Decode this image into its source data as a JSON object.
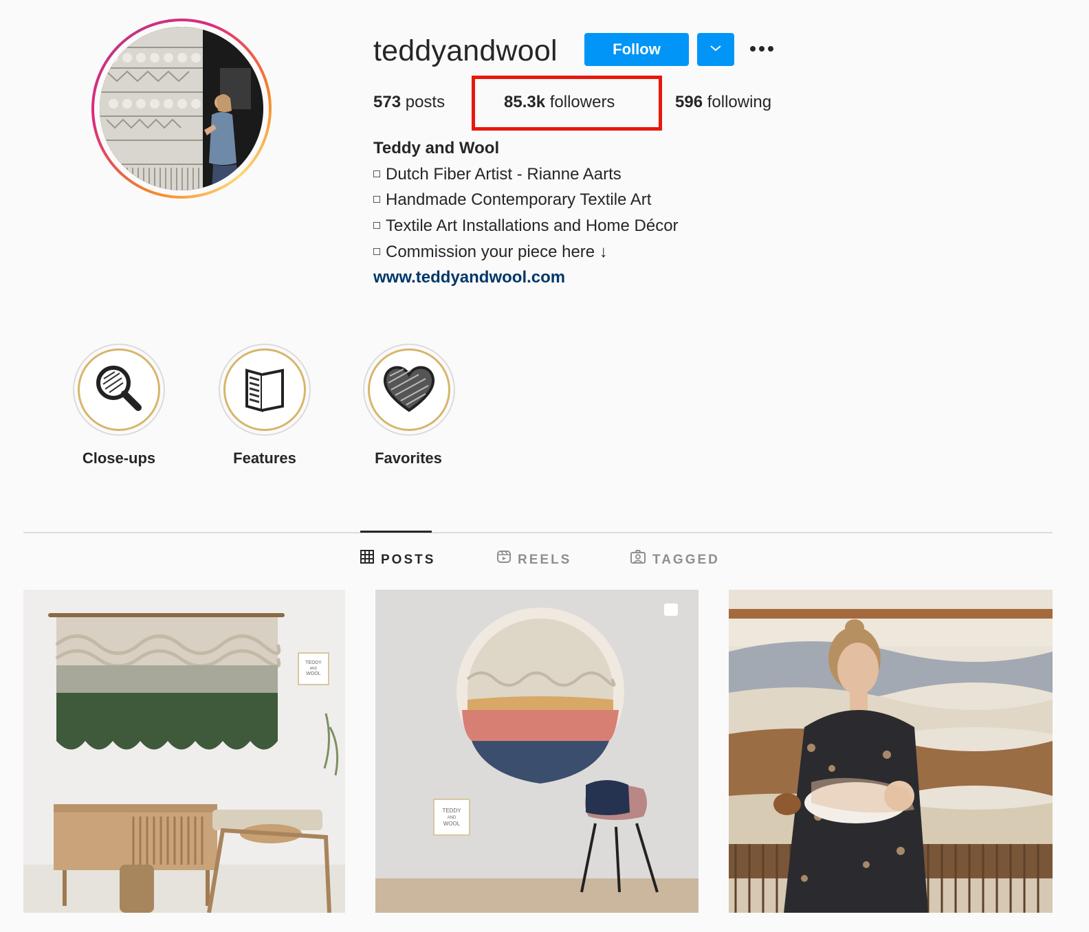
{
  "profile": {
    "username": "teddyandwool",
    "follow_label": "Follow",
    "stats": {
      "posts_count": "573",
      "posts_label": "posts",
      "followers_count": "85.3k",
      "followers_label": "followers",
      "following_count": "596",
      "following_label": "following"
    },
    "bio": {
      "name": "Teddy and Wool",
      "lines": [
        "Dutch Fiber Artist - Rianne Aarts",
        "Handmade Contemporary Textile Art",
        "Textile Art Installations and Home Décor",
        "Commission your piece here ↓"
      ],
      "link": "www.teddyandwool.com"
    }
  },
  "highlights": [
    {
      "label": "Close-ups",
      "icon": "magnifier-icon"
    },
    {
      "label": "Features",
      "icon": "book-icon"
    },
    {
      "label": "Favorites",
      "icon": "heart-icon"
    }
  ],
  "tabs": [
    {
      "label": "POSTS",
      "icon": "grid-icon",
      "active": true
    },
    {
      "label": "REELS",
      "icon": "reels-icon",
      "active": false
    },
    {
      "label": "TAGGED",
      "icon": "tagged-icon",
      "active": false
    }
  ],
  "posts": [
    {
      "kind": "image",
      "subject": "green dip-dyed macrame wall hanging above wooden sideboard",
      "watermark": {
        "line1": "TEDDY",
        "line2": "AND",
        "line3": "WOOL"
      }
    },
    {
      "kind": "carousel",
      "subject": "round macrame wall art with sunset colours beside pink chair",
      "watermark": {
        "line1": "TEDDY",
        "line2": "AND",
        "line3": "WOOL"
      }
    },
    {
      "kind": "image",
      "subject": "woman holding baby in front of large textile art"
    }
  ],
  "colors": {
    "accent": "#0095f6",
    "link": "#00376b",
    "highlight_box": "#e8180c",
    "highlight_ring": "#d8b56a"
  }
}
